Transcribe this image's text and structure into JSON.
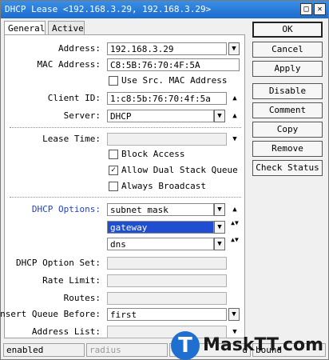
{
  "window": {
    "title": "DHCP Lease <192.168.3.29, 192.168.3.29>",
    "btn_a": "□",
    "btn_close": "✕"
  },
  "tabs": [
    {
      "label": "General"
    },
    {
      "label": "Active"
    }
  ],
  "form": {
    "address": {
      "label": "Address:",
      "value": "192.168.3.29"
    },
    "mac": {
      "label": "MAC Address:",
      "value": "C8:5B:76:70:4F:5A"
    },
    "use_src_mac": {
      "label": "Use Src. MAC Address",
      "checked": false
    },
    "client_id": {
      "label": "Client ID:",
      "value": "1:c8:5b:76:70:4f:5a"
    },
    "server": {
      "label": "Server:",
      "value": "DHCP"
    },
    "lease_time": {
      "label": "Lease Time:",
      "value": ""
    },
    "block_access": {
      "label": "Block Access",
      "checked": false
    },
    "dual_stack": {
      "label": "Allow Dual Stack Queue",
      "checked": true
    },
    "always_broadcast": {
      "label": "Always Broadcast",
      "checked": false
    },
    "dhcp_options": {
      "label": "DHCP Options:",
      "values": [
        "subnet mask",
        "gateway",
        "dns"
      ]
    },
    "dhcp_option_set": {
      "label": "DHCP Option Set:",
      "value": ""
    },
    "rate_limit": {
      "label": "Rate Limit:",
      "value": ""
    },
    "routes": {
      "label": "Routes:",
      "value": ""
    },
    "insert_queue": {
      "label": "Insert Queue Before:",
      "value": "first"
    },
    "address_list": {
      "label": "Address List:",
      "value": ""
    }
  },
  "buttons": [
    "OK",
    "Cancel",
    "Apply",
    "Disable",
    "Comment",
    "Copy",
    "Remove",
    "Check Status"
  ],
  "status": [
    "enabled",
    "radius",
    "d",
    "bound"
  ],
  "watermark": "MaskTT.com",
  "watermark_logo": "T",
  "icons": {
    "dropdown": "▼",
    "up": "▲",
    "updown": "▲▼",
    "check": "✓"
  }
}
